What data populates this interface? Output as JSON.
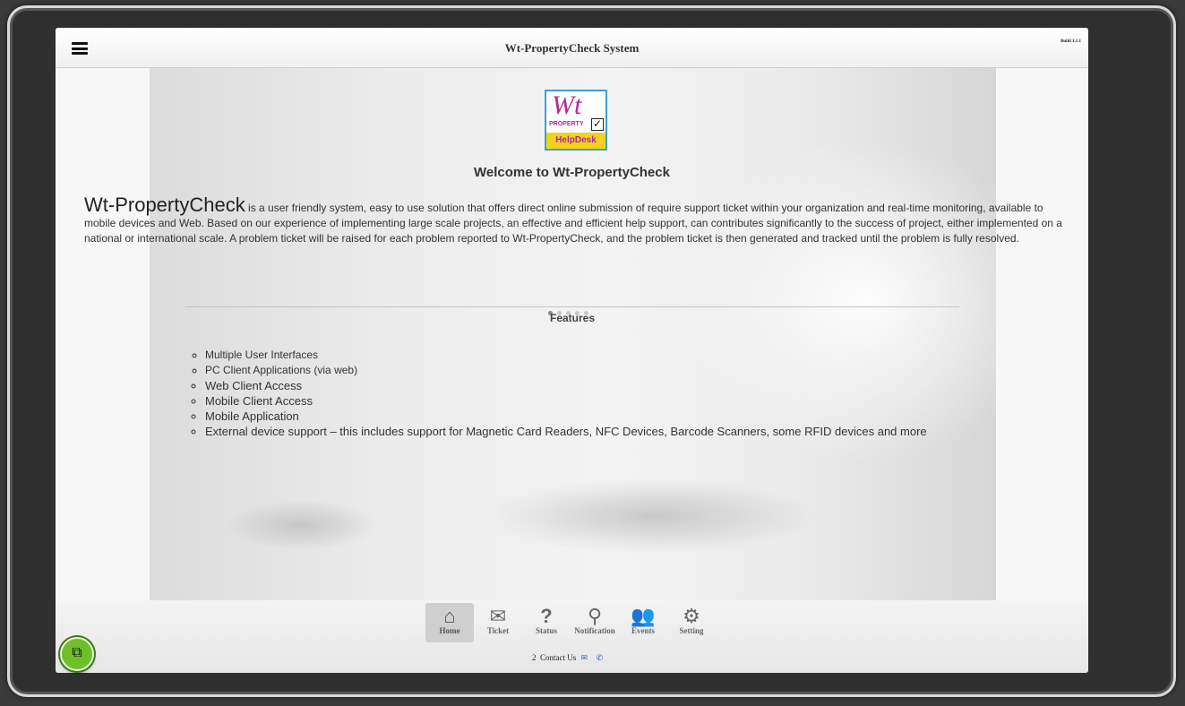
{
  "header": {
    "title": "Wt-PropertyCheck System",
    "build": "Build 1.1.1"
  },
  "logo": {
    "line1": "Wt",
    "line2": "PROPERTY",
    "line3": "HelpDesk"
  },
  "welcome": "Welcome to Wt-PropertyCheck",
  "intro": {
    "brand": "Wt-PropertyCheck",
    "text": " is a user friendly system, easy to use solution that offers direct online submission of require support ticket within your organization and real-time monitoring, available to mobile devices and Web. Based on our experience of implementing large scale projects, an effective and efficient help support, can contributes significantly to the success of project, either implemented on a national or international scale. A problem ticket will be raised for each problem reported to Wt-PropertyCheck, and the problem ticket is then generated and tracked until the problem is fully resolved."
  },
  "features": {
    "label": "Features",
    "items": [
      "Multiple User Interfaces",
      "PC Client Applications (via web)",
      "Web Client Access",
      "Mobile Client Access",
      "Mobile Application",
      "External device support – this includes support for Magnetic Card Readers, NFC Devices, Barcode Scanners, some RFID devices and more"
    ]
  },
  "nav": [
    {
      "label": "Home",
      "icon": "home-icon"
    },
    {
      "label": "Ticket",
      "icon": "envelope-icon"
    },
    {
      "label": "Status",
      "icon": "question-icon"
    },
    {
      "label": "Notification",
      "icon": "search-icon"
    },
    {
      "label": "Events",
      "icon": "users-icon"
    },
    {
      "label": "Setting",
      "icon": "gear-icon"
    }
  ],
  "footer": {
    "count": "2",
    "contact": "Contact Us"
  },
  "colors": {
    "accent_green": "#6fbf2a",
    "logo_magenta": "#b02a9a",
    "logo_yellow": "#f4d21a"
  }
}
